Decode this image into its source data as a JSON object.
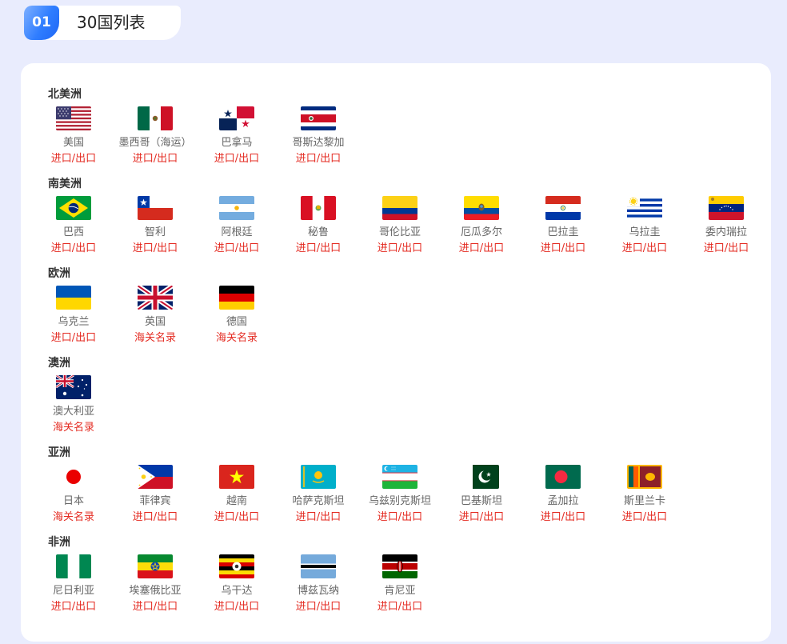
{
  "header": {
    "badge": "01",
    "title": "30国列表"
  },
  "regions": [
    {
      "title": "北美洲",
      "countries": [
        {
          "name": "美国",
          "link": "进口/出口",
          "flag": "usa-flag-icon"
        },
        {
          "name": "墨西哥（海运）",
          "link": "进口/出口",
          "flag": "mexico-flag-icon"
        },
        {
          "name": "巴拿马",
          "link": "进口/出口",
          "flag": "panama-flag-icon"
        },
        {
          "name": "哥斯达黎加",
          "link": "进口/出口",
          "flag": "costa-rica-flag-icon"
        }
      ]
    },
    {
      "title": "南美洲",
      "countries": [
        {
          "name": "巴西",
          "link": "进口/出口",
          "flag": "brazil-flag-icon"
        },
        {
          "name": "智利",
          "link": "进口/出口",
          "flag": "chile-flag-icon"
        },
        {
          "name": "阿根廷",
          "link": "进口/出口",
          "flag": "argentina-flag-icon"
        },
        {
          "name": "秘鲁",
          "link": "进口/出口",
          "flag": "peru-flag-icon"
        },
        {
          "name": "哥伦比亚",
          "link": "进口/出口",
          "flag": "colombia-flag-icon"
        },
        {
          "name": "厄瓜多尔",
          "link": "进口/出口",
          "flag": "ecuador-flag-icon"
        },
        {
          "name": "巴拉圭",
          "link": "进口/出口",
          "flag": "paraguay-flag-icon"
        },
        {
          "name": "乌拉圭",
          "link": "进口/出口",
          "flag": "uruguay-flag-icon"
        },
        {
          "name": "委内瑞拉",
          "link": "进口/出口",
          "flag": "venezuela-flag-icon"
        }
      ]
    },
    {
      "title": "欧洲",
      "countries": [
        {
          "name": "乌克兰",
          "link": "进口/出口",
          "flag": "ukraine-flag-icon"
        },
        {
          "name": "英国",
          "link": "海关名录",
          "flag": "uk-flag-icon"
        },
        {
          "name": "德国",
          "link": "海关名录",
          "flag": "germany-flag-icon"
        }
      ]
    },
    {
      "title": "澳洲",
      "countries": [
        {
          "name": "澳大利亚",
          "link": "海关名录",
          "flag": "australia-flag-icon"
        }
      ]
    },
    {
      "title": "亚洲",
      "countries": [
        {
          "name": "日本",
          "link": "海关名录",
          "flag": "japan-flag-icon"
        },
        {
          "name": "菲律宾",
          "link": "进口/出口",
          "flag": "philippines-flag-icon"
        },
        {
          "name": "越南",
          "link": "进口/出口",
          "flag": "vietnam-flag-icon"
        },
        {
          "name": "哈萨克斯坦",
          "link": "进口/出口",
          "flag": "kazakhstan-flag-icon"
        },
        {
          "name": "乌兹别克斯坦",
          "link": "进口/出口",
          "flag": "uzbekistan-flag-icon"
        },
        {
          "name": "巴基斯坦",
          "link": "进口/出口",
          "flag": "pakistan-flag-icon"
        },
        {
          "name": "孟加拉",
          "link": "进口/出口",
          "flag": "bangladesh-flag-icon"
        },
        {
          "name": "斯里兰卡",
          "link": "进口/出口",
          "flag": "sri-lanka-flag-icon"
        }
      ]
    },
    {
      "title": "非洲",
      "countries": [
        {
          "name": "尼日利亚",
          "link": "进口/出口",
          "flag": "nigeria-flag-icon"
        },
        {
          "name": "埃塞俄比亚",
          "link": "进口/出口",
          "flag": "ethiopia-flag-icon"
        },
        {
          "name": "乌干达",
          "link": "进口/出口",
          "flag": "uganda-flag-icon"
        },
        {
          "name": "博兹瓦纳",
          "link": "进口/出口",
          "flag": "botswana-flag-icon"
        },
        {
          "name": "肯尼亚",
          "link": "进口/出口",
          "flag": "kenya-flag-icon"
        }
      ]
    }
  ],
  "colors": {
    "accent_blue": "#2f7dff",
    "link_red": "#e42b22",
    "background": "#e9ecfd"
  }
}
